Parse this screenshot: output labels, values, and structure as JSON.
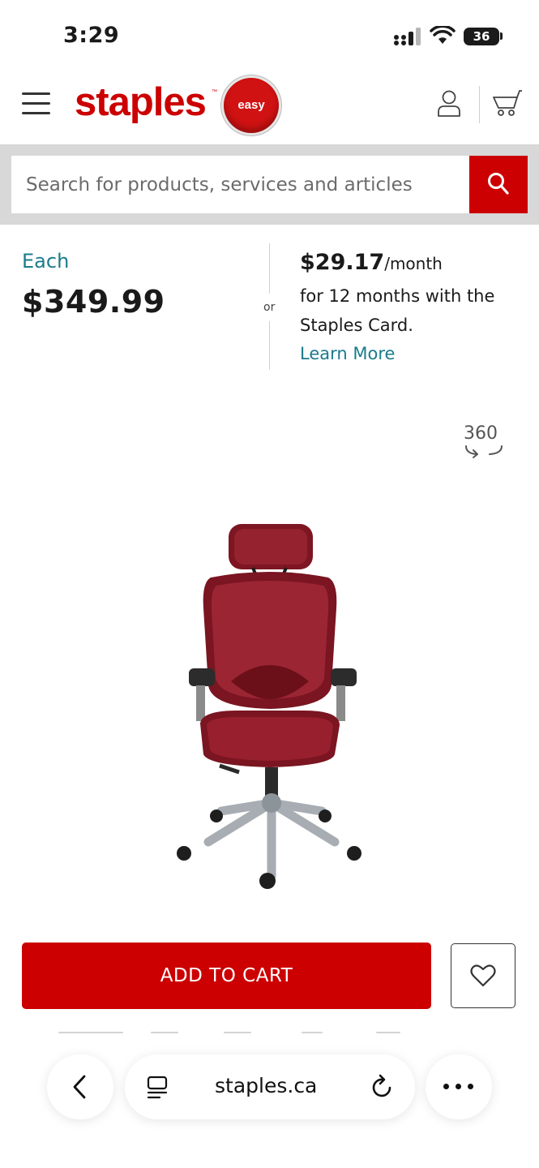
{
  "status_bar": {
    "time": "3:29",
    "battery_level": "36",
    "icons": [
      "cellular-signal-icon",
      "wifi-icon",
      "battery-icon"
    ]
  },
  "header": {
    "logo_text": "staples",
    "logo_tm": "™",
    "easy_button_label": "easy",
    "icons": [
      "menu-icon",
      "account-icon",
      "cart-icon"
    ],
    "brand_color": "#cc0000"
  },
  "search": {
    "placeholder": "Search for products, services and articles",
    "value": "",
    "icon": "search-icon"
  },
  "pricing": {
    "each_label": "Each",
    "price": "$349.99",
    "or_label": "or",
    "monthly_price": "$29.17",
    "monthly_unit": "/month",
    "financing_line1": "for 12 months with the",
    "financing_line2": "Staples Card.",
    "learn_more": "Learn More",
    "accent_color": "#1b7b8c"
  },
  "product_viewer": {
    "view_360_label": "360",
    "image_alt": "Red mesh office chair with headrest"
  },
  "actions": {
    "add_to_cart_label": "ADD TO CART",
    "wishlist_icon": "heart-icon"
  },
  "browser": {
    "url": "staples.ca",
    "icons": [
      "back-icon",
      "tabs-icon",
      "reload-icon",
      "more-icon"
    ]
  }
}
